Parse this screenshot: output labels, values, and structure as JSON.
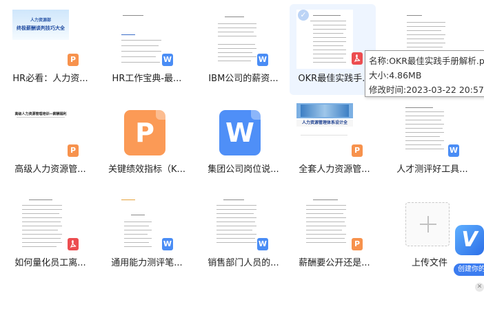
{
  "files": [
    {
      "name": "HR必看：人力资...",
      "type": "p",
      "badge": "P",
      "cover_line1": "人力资源部",
      "cover_line2": "终极薪酬谈判技巧大全"
    },
    {
      "name": "HR工作宝典-最...",
      "type": "w",
      "badge": "W"
    },
    {
      "name": "IBM公司的薪资...",
      "type": "w",
      "badge": "W"
    },
    {
      "name": "OKR最佳实践手...",
      "type": "pdf",
      "badge": "",
      "selected": true
    },
    {
      "name": "高级人力资源管...",
      "type": "p",
      "badge": "P",
      "cover_title": "高级人力资源管理培训—薪酬福利"
    },
    {
      "name": "关键绩效指标（K...",
      "type": "p",
      "badge": "P"
    },
    {
      "name": "集团公司岗位说...",
      "type": "w",
      "badge": "W"
    },
    {
      "name": "全套人力资源管...",
      "type": "p",
      "badge": "P",
      "cover_caption": "人力资源管理体系设计全"
    },
    {
      "name": "人才测评好工具...",
      "type": "w",
      "badge": "W"
    },
    {
      "name": "如何量化员工离...",
      "type": "pdf",
      "badge": ""
    },
    {
      "name": "通用能力测评笔...",
      "type": "w",
      "badge": "W"
    },
    {
      "name": "销售部门人员的...",
      "type": "w",
      "badge": "W"
    },
    {
      "name": "薪酬要公开还是...",
      "type": "p",
      "badge": "P"
    }
  ],
  "upload": {
    "label": "上传文件"
  },
  "tooltip": {
    "name": "名称:OKR最佳实践手册解析.pdf",
    "size": "大小:4.86MB",
    "modified": "修改时间:2023-03-22 20:57"
  },
  "promo": {
    "icon_letter": "V",
    "text": "创建你的"
  },
  "colors": {
    "p": "#fb9a56",
    "w": "#4f8ff7",
    "pdf": "#ec4d50",
    "hover": "#eef5ff"
  }
}
